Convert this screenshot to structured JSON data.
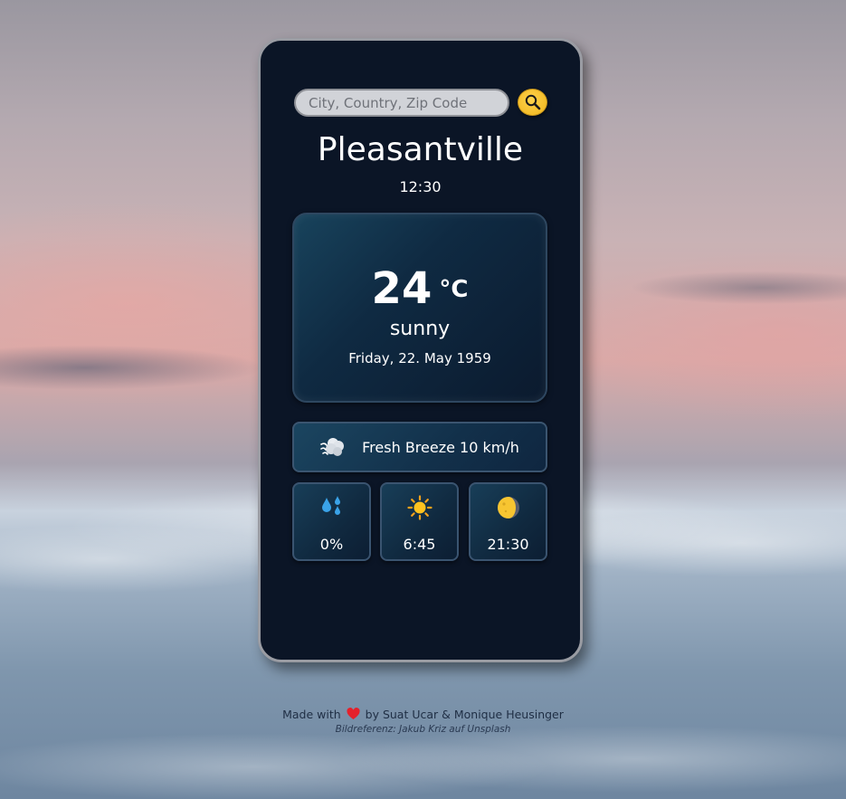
{
  "search": {
    "placeholder": "City, Country, Zip Code",
    "value": ""
  },
  "location": {
    "city": "Pleasantville",
    "time": "12:30"
  },
  "weather": {
    "temperature": "24",
    "unit": "°C",
    "condition": "sunny",
    "date": "Friday, 22. May 1959"
  },
  "wind": {
    "label": "Fresh Breeze 10 km/h",
    "icon": "wind-icon"
  },
  "details": [
    {
      "icon": "rain-drops-icon",
      "value": "0%"
    },
    {
      "icon": "sun-icon",
      "value": "6:45"
    },
    {
      "icon": "moon-icon",
      "value": "21:30"
    }
  ],
  "footer": {
    "made_with": "Made with",
    "by": "by Suat Ucar & Monique Heusinger",
    "credit": "Bildreferenz: Jakub Kriz auf Unsplash"
  },
  "colors": {
    "panel": "#0b1526",
    "accent": "#f0b51a"
  }
}
